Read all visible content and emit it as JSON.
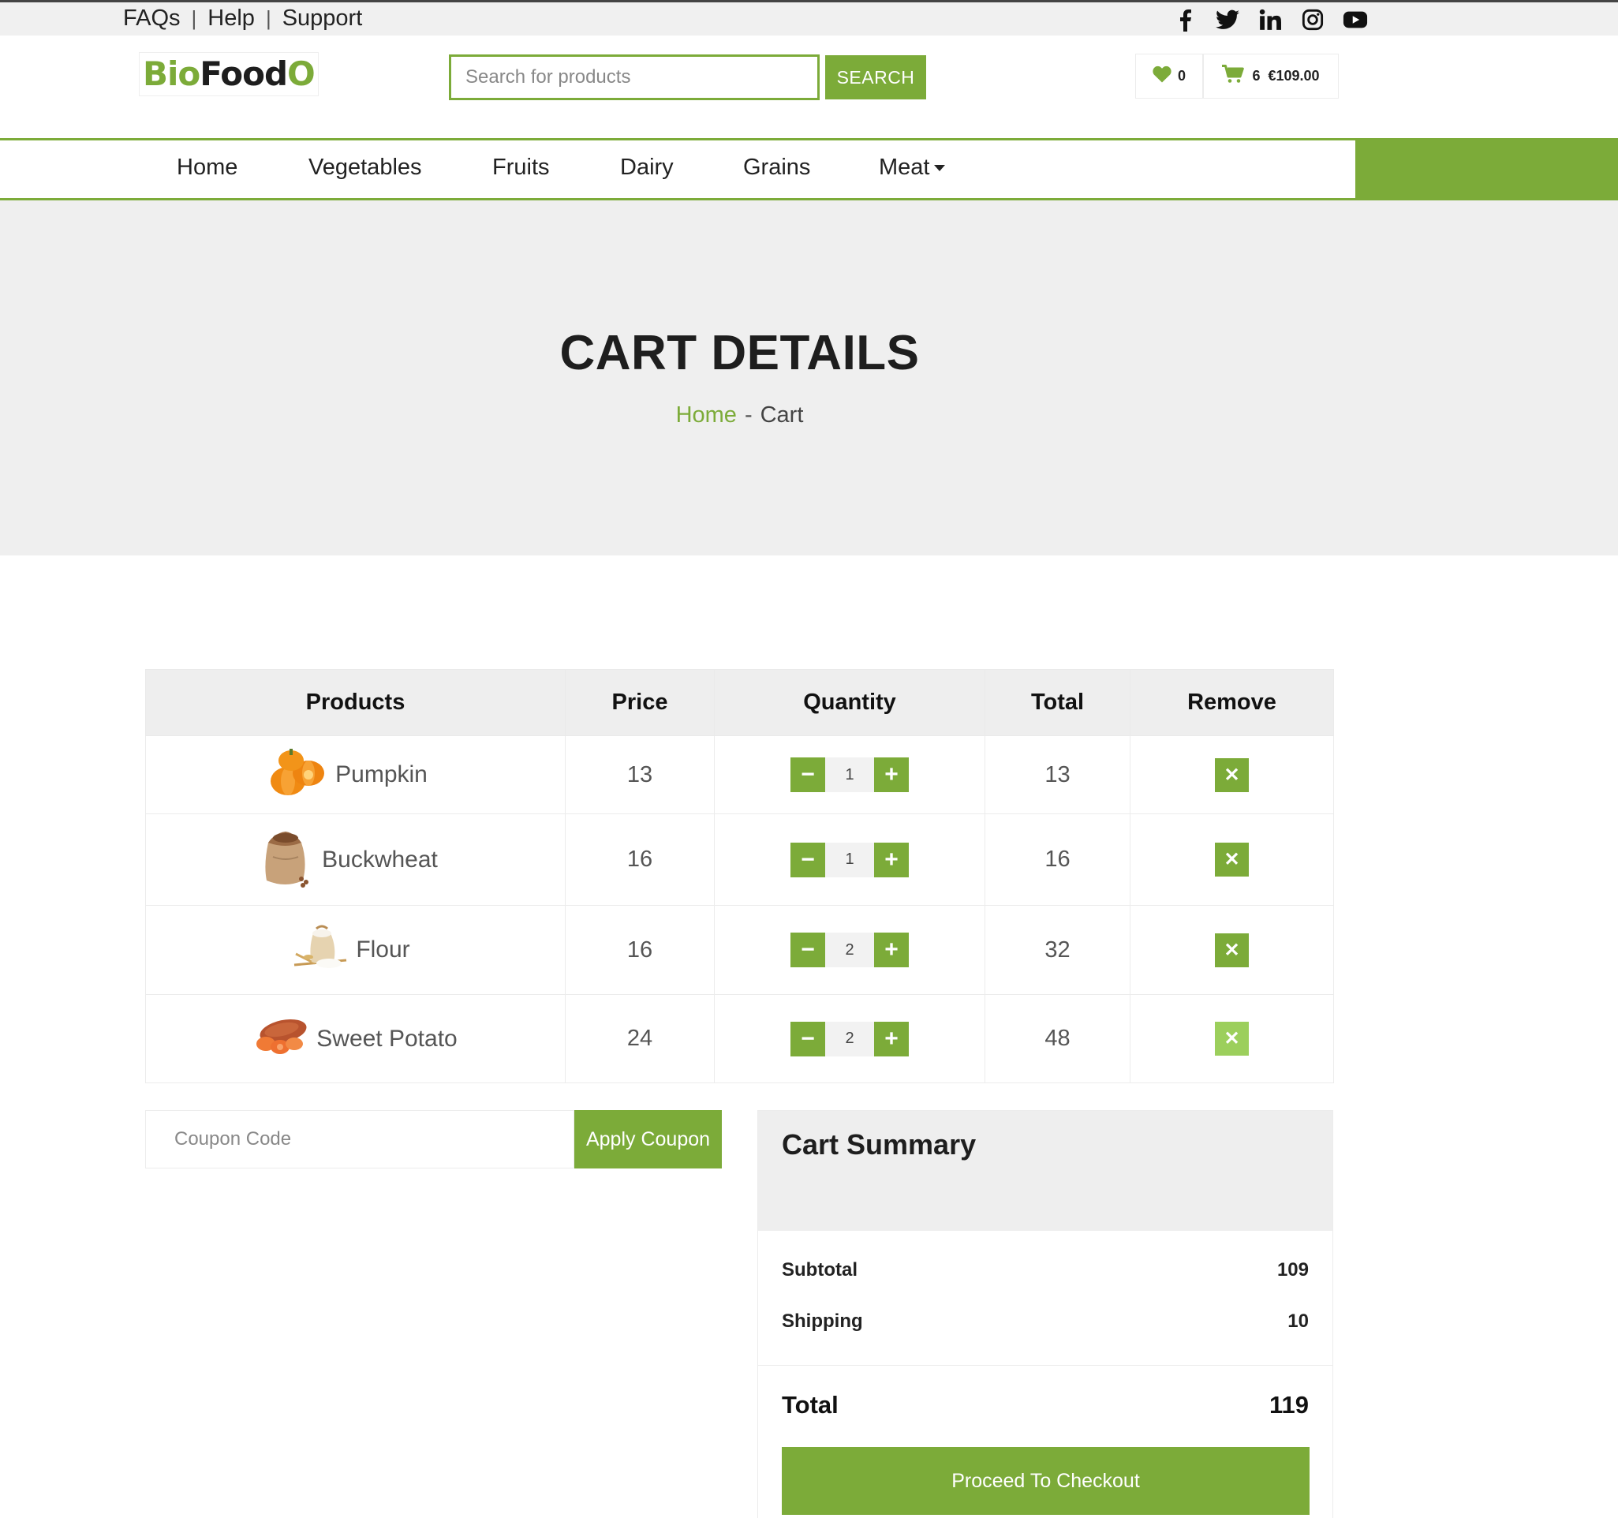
{
  "topbar": {
    "links": [
      "FAQs",
      "Help",
      "Support"
    ],
    "social_icons": [
      "facebook-icon",
      "twitter-icon",
      "linkedin-icon",
      "instagram-icon",
      "youtube-icon"
    ]
  },
  "header": {
    "logo": {
      "part1": "Bio",
      "part2": "Food",
      "part3": "O"
    },
    "search": {
      "placeholder": "Search for products",
      "button_label": "SEARCH"
    },
    "wishlist": {
      "count": "0"
    },
    "cart": {
      "count": "6",
      "amount": "€109.00"
    }
  },
  "nav": {
    "items": [
      "Home",
      "Vegetables",
      "Fruits",
      "Dairy",
      "Grains",
      "Meat"
    ]
  },
  "hero": {
    "title": "CART DETAILS",
    "breadcrumb": {
      "home": "Home",
      "separator": "-",
      "current": "Cart"
    }
  },
  "cart": {
    "headers": [
      "Products",
      "Price",
      "Quantity",
      "Total",
      "Remove"
    ],
    "rows": [
      {
        "name": "Pumpkin",
        "price": "13",
        "qty": "1",
        "total": "13"
      },
      {
        "name": "Buckwheat",
        "price": "16",
        "qty": "1",
        "total": "16"
      },
      {
        "name": "Flour",
        "price": "16",
        "qty": "2",
        "total": "32"
      },
      {
        "name": "Sweet Potato",
        "price": "24",
        "qty": "2",
        "total": "48"
      }
    ],
    "minus": "−",
    "plus": "+",
    "remove": "✕"
  },
  "coupon": {
    "placeholder": "Coupon Code",
    "button_label": "Apply Coupon"
  },
  "summary": {
    "title": "Cart Summary",
    "subtotal_label": "Subtotal",
    "subtotal_value": "109",
    "shipping_label": "Shipping",
    "shipping_value": "10",
    "total_label": "Total",
    "total_value": "119",
    "checkout_label": "Proceed To Checkout"
  },
  "colors": {
    "accent": "#7cab39",
    "accent_light": "#9ccf5c",
    "band": "#efefef"
  }
}
